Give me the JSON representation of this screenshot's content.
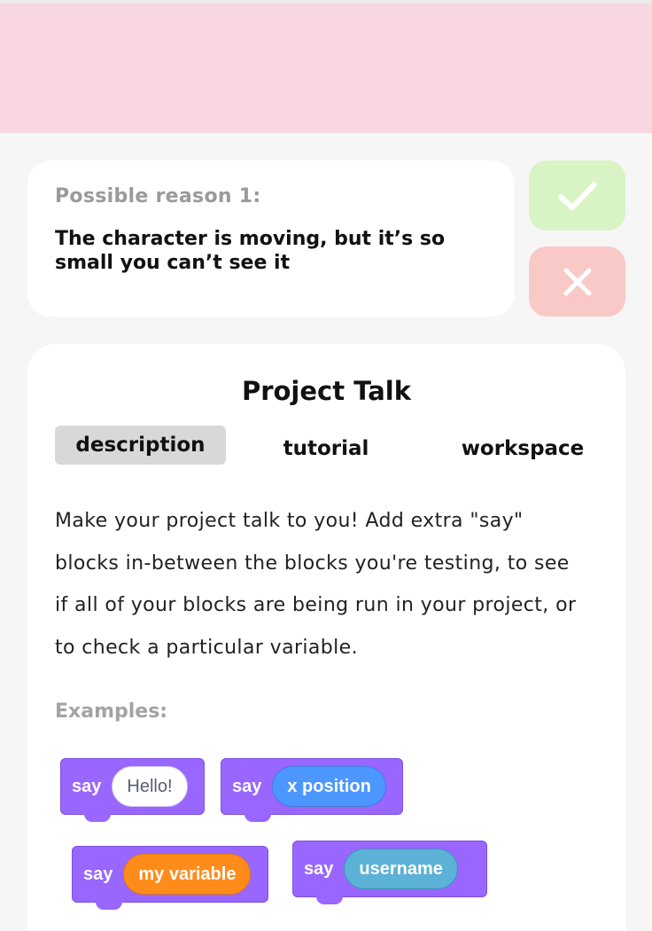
{
  "reason": {
    "label": "Possible reason 1:",
    "text": "The character is moving, but it’s so small you can’t see it"
  },
  "actions": {
    "confirm_icon": "checkmark-icon",
    "reject_icon": "x-mark-icon"
  },
  "tool": {
    "title": "Project Talk",
    "tabs": [
      {
        "label": "description",
        "active": true
      },
      {
        "label": "tutorial",
        "active": false
      },
      {
        "label": "workspace",
        "active": false
      }
    ],
    "description": "Make your project talk to you! Add extra \"say\" blocks in-between the blocks you're testing, to see if all of your blocks are being run in your project, or to check a particular variable.",
    "examples_label": "Examples:",
    "examples": [
      {
        "keyword": "say",
        "value": "Hello!"
      },
      {
        "keyword": "say",
        "value": "x position"
      },
      {
        "keyword": "say",
        "value": "my variable"
      },
      {
        "keyword": "say",
        "value": "username"
      }
    ]
  },
  "colors": {
    "banner": "#f8d7e0",
    "confirm": "#d8f4c4",
    "reject": "#f9c9c8",
    "block_purple": "#9966ff",
    "pill_blue": "#4c97ff",
    "pill_orange": "#ff8c1a",
    "pill_teal": "#5cb1d6"
  }
}
